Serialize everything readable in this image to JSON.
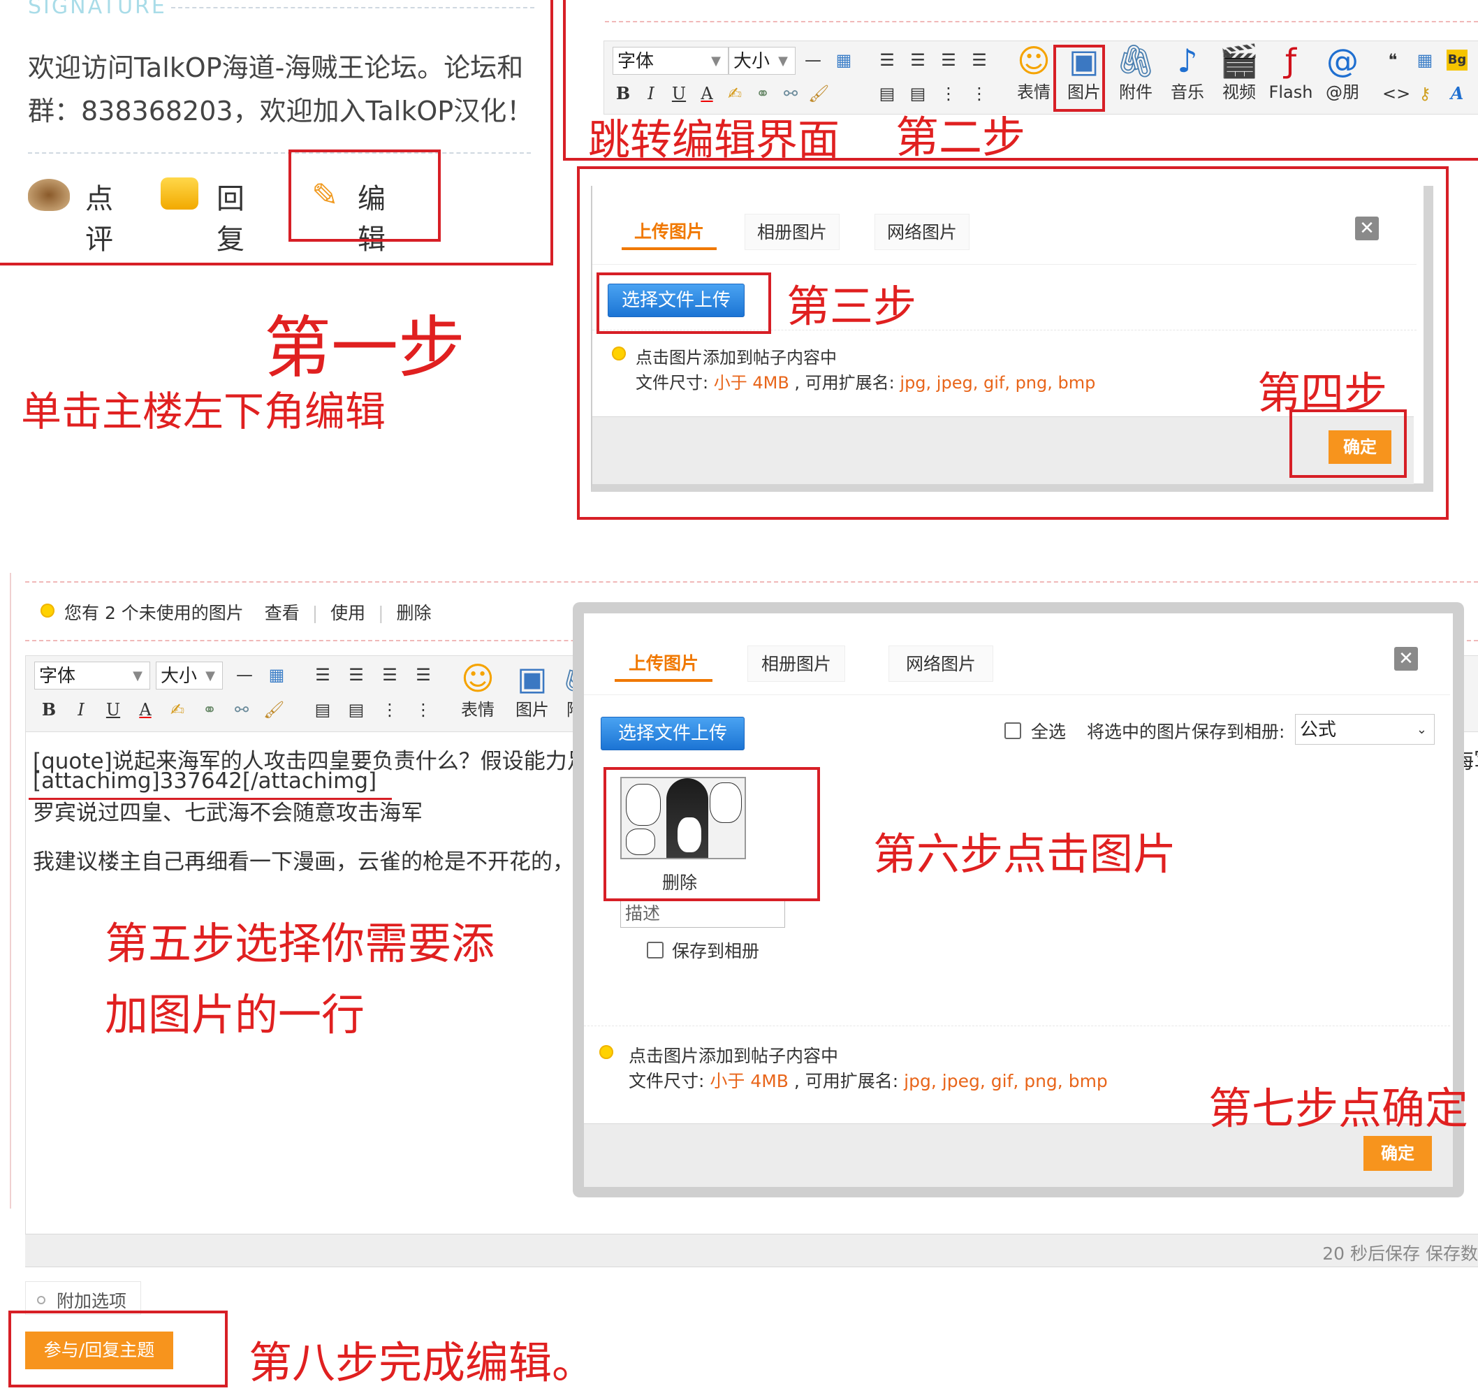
{
  "colors": {
    "annotation": "#e02020",
    "box": "#d71f26",
    "orange_btn": "#f7941d",
    "orange_text": "#e8651a",
    "blue_btn": "#2f88e2"
  },
  "post": {
    "signature_label": "SIGNATURE",
    "welcome_line1": "欢迎访问TalkOP海道-海贼王论坛。论坛和",
    "welcome_line2": "群：838368203，欢迎加入TalkOP汉化！",
    "actions": [
      {
        "icon": "coffee-cup-icon",
        "label": "点评"
      },
      {
        "icon": "speech-bubble-icon",
        "label": "回复"
      },
      {
        "icon": "pencil-icon",
        "label": "编辑"
      }
    ]
  },
  "steps": {
    "step1_title": "第一步",
    "step1_desc": "单击主楼左下角编辑",
    "step2_title": "第二步",
    "step2_desc": "跳转编辑界面",
    "step3": "第三步",
    "step4": "第四步",
    "step5_line1": "第五步选择你需要添",
    "step5_line2": "加图片的一行",
    "step6": "第六步点击图片",
    "step7": "第七步点确定",
    "step8": "第八步完成编辑。"
  },
  "toolbar": {
    "font_select": "字体",
    "size_select": "大小",
    "hr_glyph": "—",
    "bold": "B",
    "italic": "I",
    "underline": "U",
    "color": "A",
    "big_buttons": [
      {
        "icon": "smiley-icon",
        "label": "表情"
      },
      {
        "icon": "image-icon",
        "label": "图片"
      },
      {
        "icon": "paperclip-icon",
        "label": "附件"
      },
      {
        "icon": "music-note-icon",
        "label": "音乐"
      },
      {
        "icon": "film-icon",
        "label": "视频"
      },
      {
        "icon": "flash-icon",
        "label": "Flash"
      },
      {
        "icon": "at-icon",
        "label": "@朋"
      }
    ],
    "bg_label": "Bg",
    "quote_glyph": "❝",
    "code_glyph": "<>"
  },
  "dialog": {
    "tabs": [
      "上传图片",
      "相册图片",
      "网络图片"
    ],
    "close": "✕",
    "upload_button": "选择文件上传",
    "hint_line1": "点击图片添加到帖子内容中",
    "hint_size_label": "文件尺寸: ",
    "hint_size_value": "小于 4MB",
    "hint_ext_label": " , 可用扩展名: ",
    "hint_ext_value": "jpg, jpeg, gif, png, bmp",
    "confirm": "确定",
    "select_all": "全选",
    "save_to_album_label": "将选中的图片保存到相册:",
    "album_select": "公式",
    "thumb_delete": "删除",
    "desc_placeholder": "描述",
    "save_checkbox": "保存到相册"
  },
  "editor": {
    "notice": "您有 2 个未使用的图片",
    "notice_links": [
      "查看",
      "使用",
      "删除"
    ],
    "big_buttons": [
      {
        "icon": "smiley-icon",
        "label": "表情"
      },
      {
        "icon": "image-icon",
        "label": "图片"
      },
      {
        "icon": "paperclip-icon",
        "label": "附"
      }
    ],
    "line1": "[quote]说起来海军的人攻击四皇要负责什么？假设能力足够",
    "line2": "[attachimg]337642[/attachimg]",
    "line3": "罗宾说过四皇、七武海不会随意攻击海军",
    "line4": "我建议楼主自己再细看一下漫画，云雀的枪是不开花的，是海",
    "right_clip": "海军",
    "autosave": "20 秒后保存 保存数",
    "extra_options": "附加选项",
    "submit": "参与/回复主题"
  }
}
